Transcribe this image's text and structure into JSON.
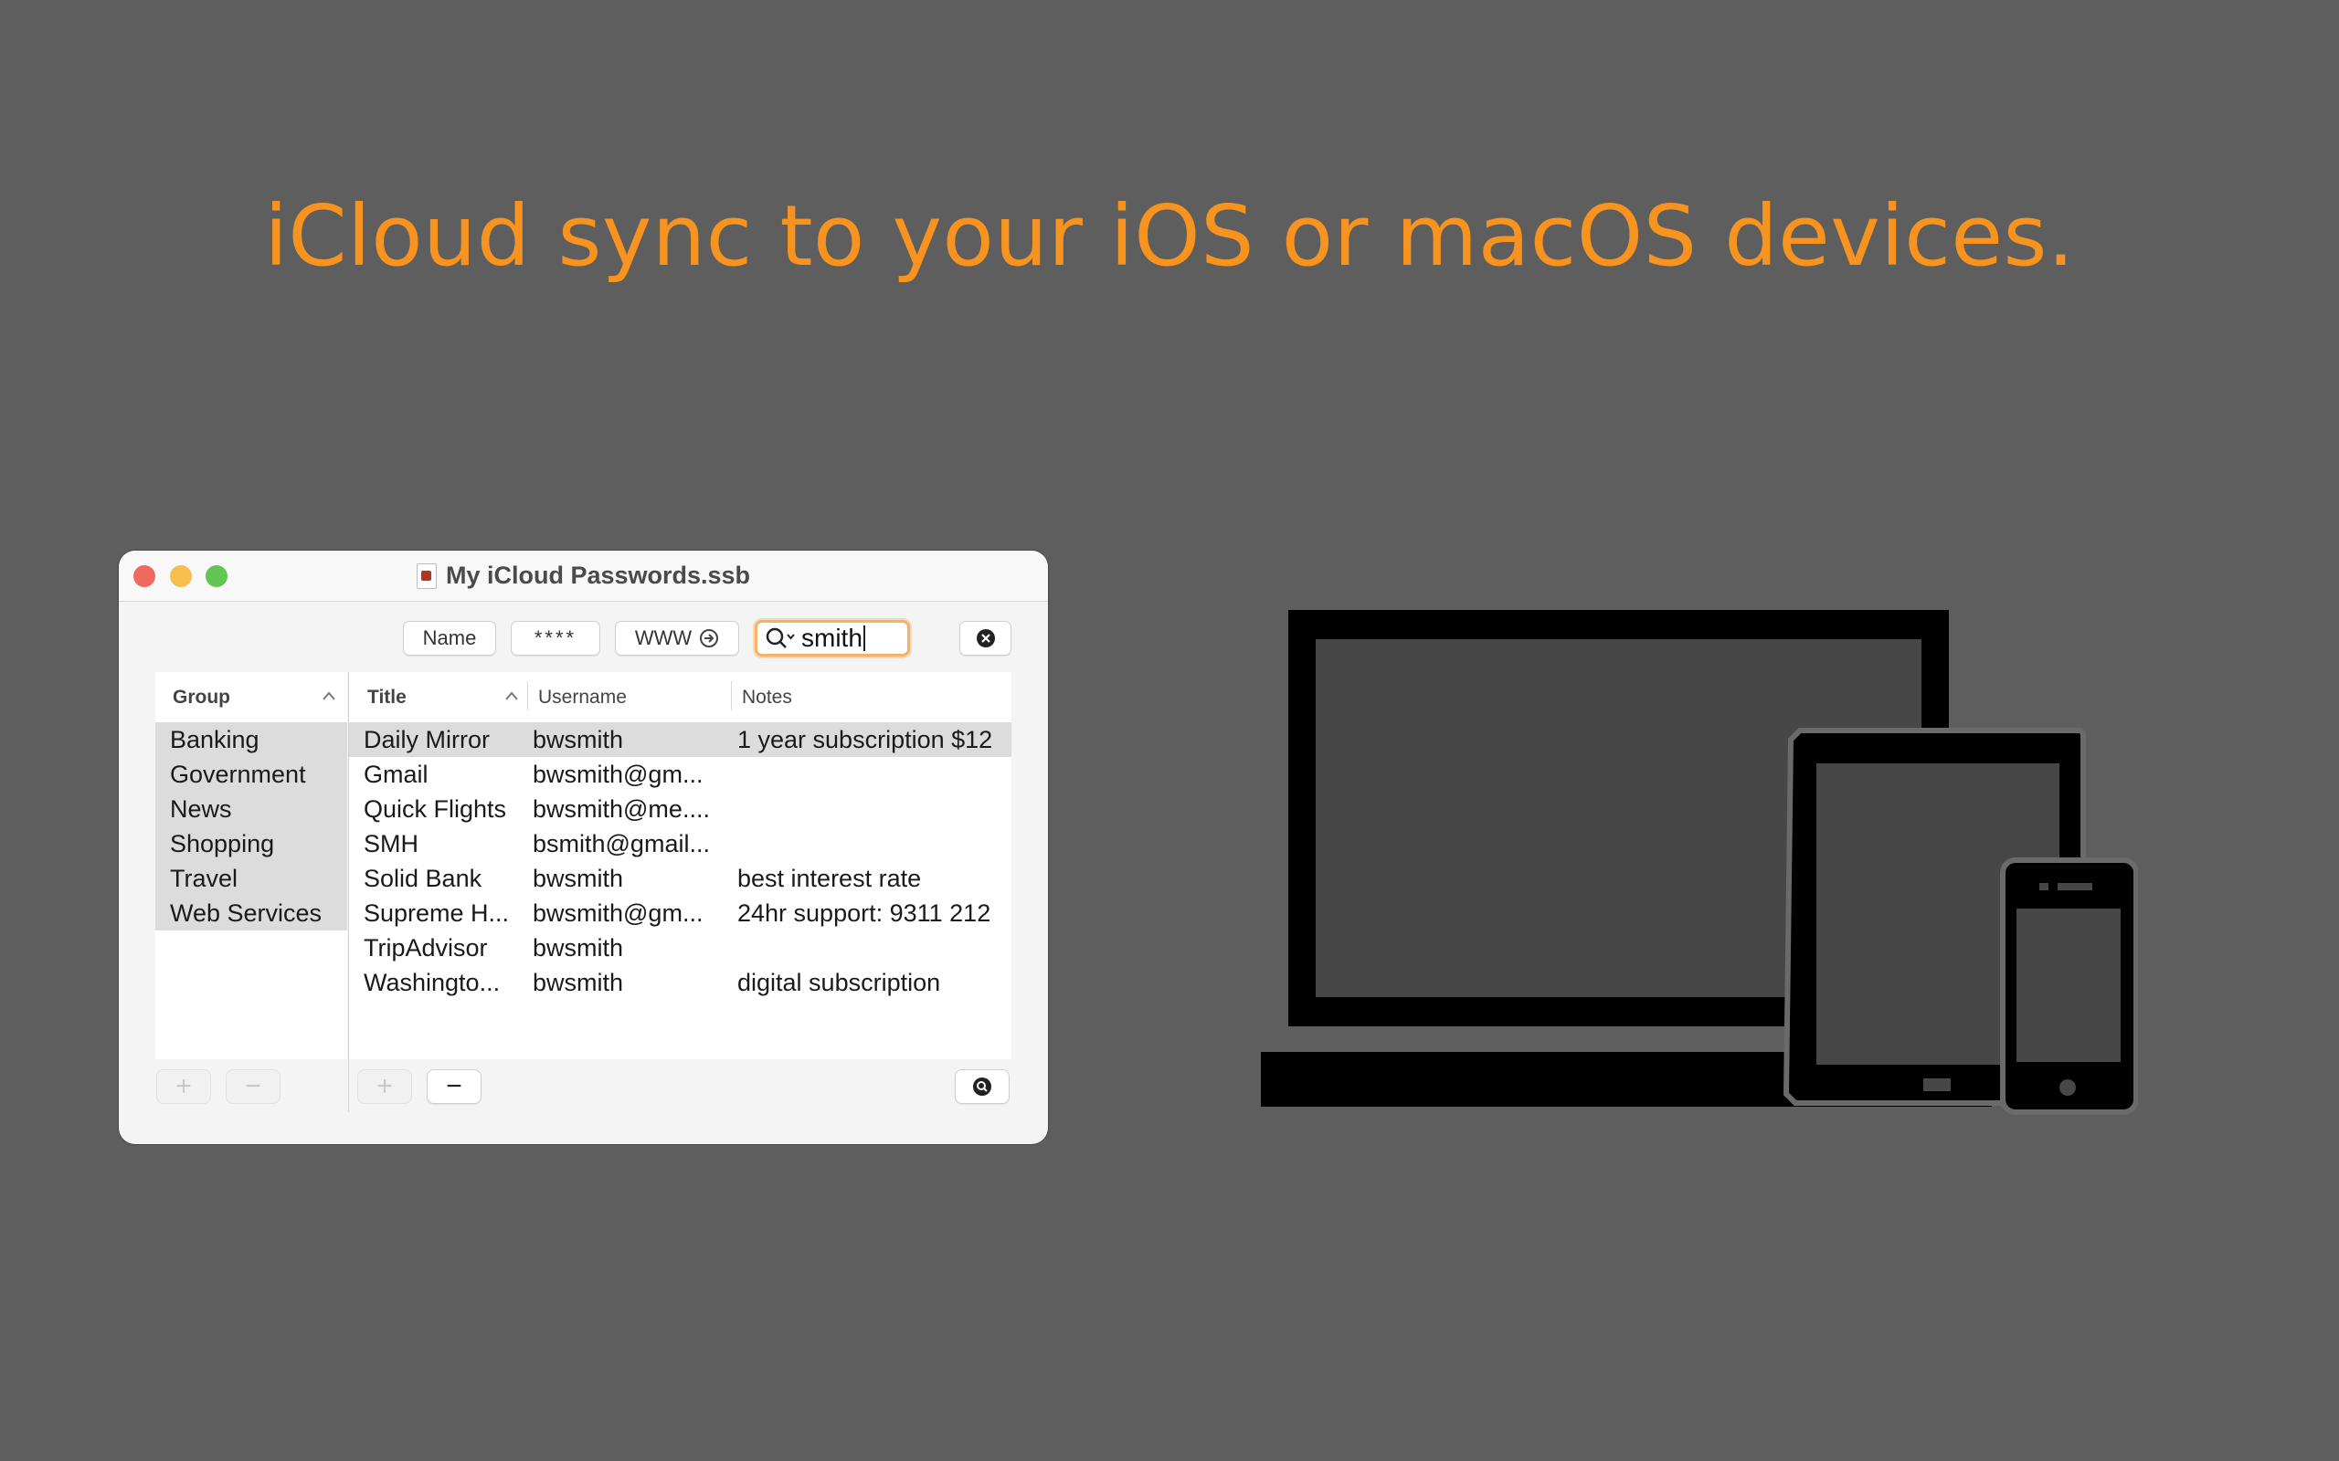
{
  "headline": "iCloud sync to your iOS or macOS devices.",
  "colors": {
    "accent": "#f7931e",
    "background": "#5e5e5e"
  },
  "window": {
    "title": "My iCloud Passwords.ssb",
    "toolbar": {
      "name_label": "Name",
      "password_label": "****",
      "www_label": "WWW",
      "search_value": "smith"
    },
    "groups": {
      "header": "Group",
      "items": [
        "Banking",
        "Government",
        "News",
        "Shopping",
        "Travel",
        "Web Services"
      ]
    },
    "entries": {
      "columns": [
        "Title",
        "Username",
        "Notes"
      ],
      "rows": [
        {
          "title": "Daily Mirror",
          "username": "bwsmith",
          "notes": "1 year subscription $12"
        },
        {
          "title": "Gmail",
          "username": "bwsmith@gm...",
          "notes": ""
        },
        {
          "title": "Quick Flights",
          "username": "bwsmith@me....",
          "notes": ""
        },
        {
          "title": "SMH",
          "username": "bsmith@gmail...",
          "notes": ""
        },
        {
          "title": "Solid Bank",
          "username": "bwsmith",
          "notes": "best interest rate"
        },
        {
          "title": "Supreme H...",
          "username": "bwsmith@gm...",
          "notes": "24hr support: 9311 212"
        },
        {
          "title": "TripAdvisor",
          "username": "bwsmith",
          "notes": ""
        },
        {
          "title": "Washingto...",
          "username": "bwsmith",
          "notes": "digital subscription"
        }
      ]
    },
    "bottom": {
      "add_label": "+",
      "remove_label": "−"
    }
  },
  "icons": [
    "search-icon",
    "clear-icon",
    "arrow-circle-icon",
    "sort-ascending-icon",
    "magnify-icon",
    "laptop-icon",
    "tablet-icon",
    "phone-icon"
  ]
}
